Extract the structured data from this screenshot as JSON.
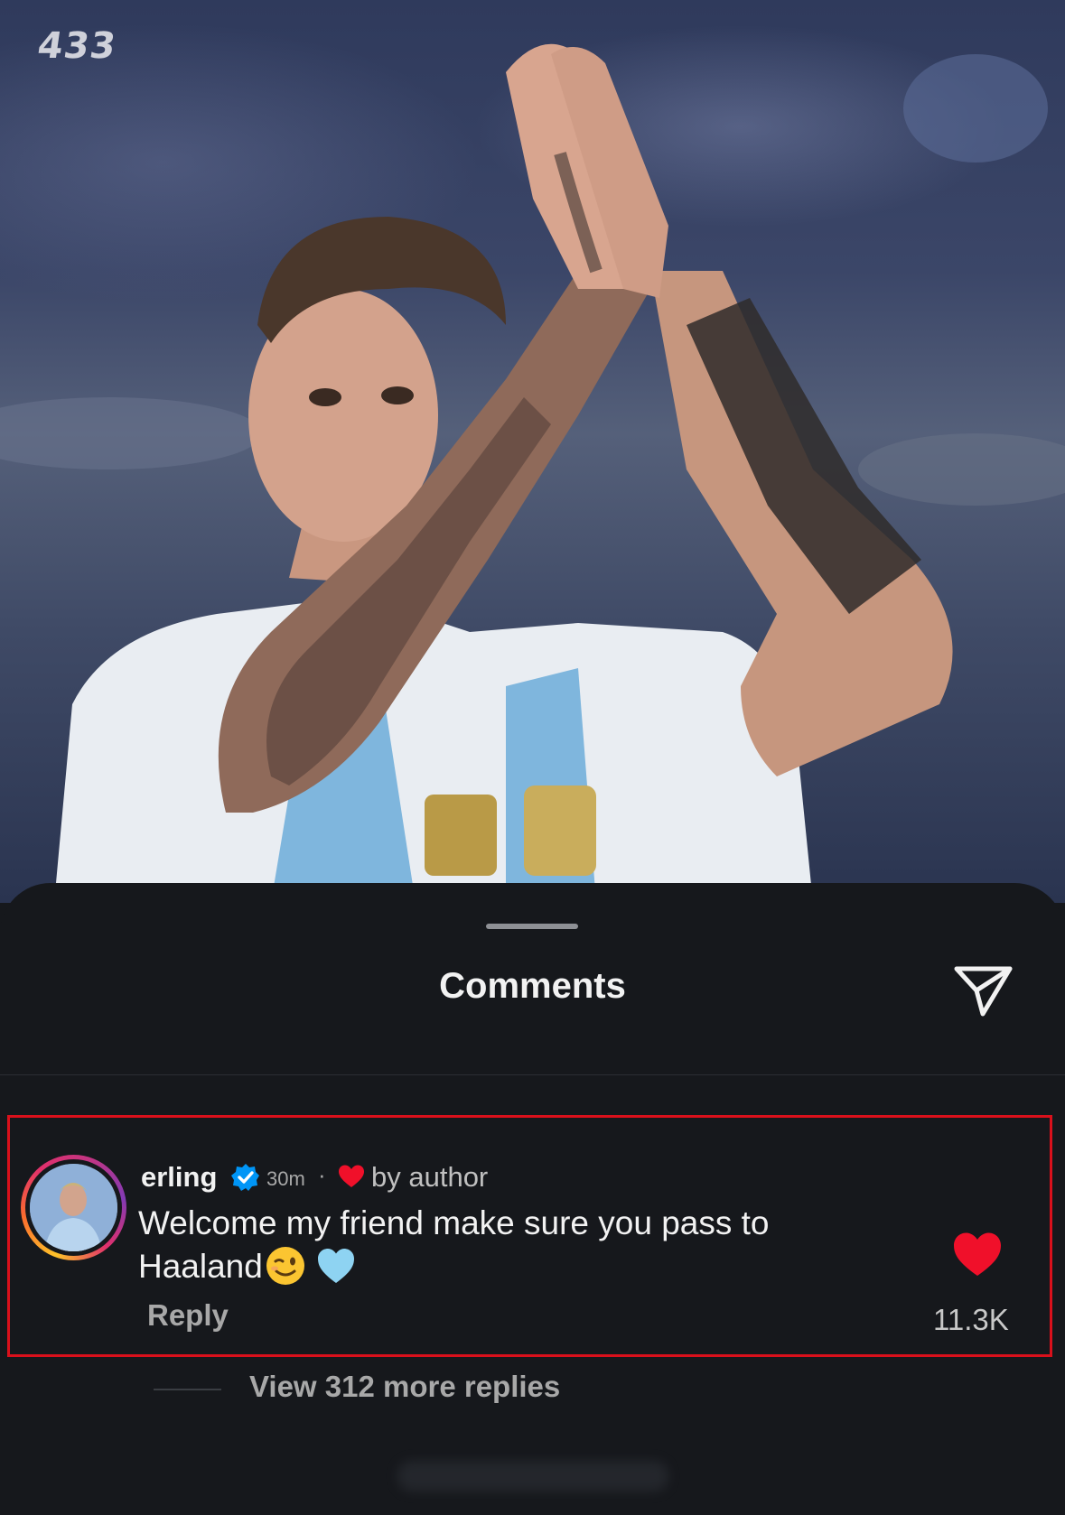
{
  "photo": {
    "brand": "433",
    "description_icon": "player-photo"
  },
  "sheet": {
    "title": "Comments",
    "share_icon": "paper-plane-icon"
  },
  "comment": {
    "username": "erling",
    "verified": true,
    "time": "30m",
    "separator": "·",
    "liked_by_author_label": "by author",
    "text": "Welcome my friend make sure you pass to Haaland",
    "emojis": [
      "winking-face-emoji",
      "light-blue-heart-emoji"
    ],
    "reply_label": "Reply",
    "like_count": "11.3K",
    "liked": true
  },
  "replies": {
    "label": "View 312 more replies"
  },
  "colors": {
    "sheet_bg": "#16181c",
    "highlight": "#d9101b",
    "heart": "#f0102a",
    "verified": "#0095f6"
  }
}
